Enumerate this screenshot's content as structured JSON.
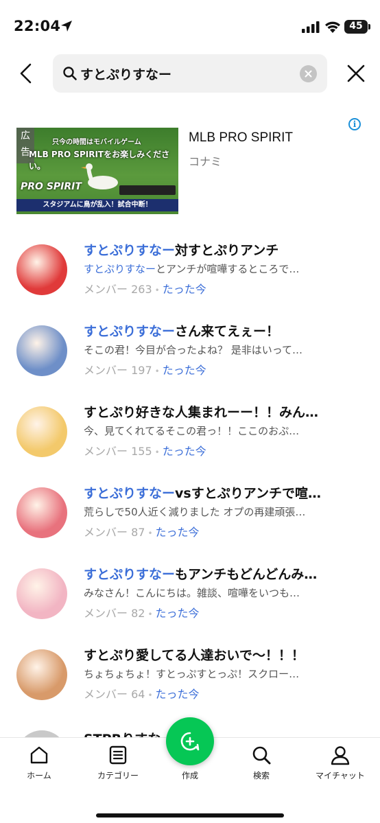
{
  "status_bar": {
    "time": "22:04",
    "battery": "45",
    "icons": [
      "location-arrow-icon",
      "cellular-signal-icon",
      "wifi-icon",
      "battery-icon"
    ]
  },
  "search": {
    "query": "すとぷりすなー",
    "icons": [
      "back-chevron-icon",
      "search-icon",
      "clear-icon",
      "close-x-icon"
    ]
  },
  "ad": {
    "badge": "広告",
    "image_caption": "只今の時間はモバイルゲーム",
    "image_headline": "MLB PRO SPIRITをお楽しみください。",
    "image_logo": "PRO SPIRIT",
    "image_banner": "スタジアムに鳥が乱入！試合中断！",
    "title": "MLB PRO SPIRIT",
    "sponsor": "コナミ",
    "info_icon": "info-icon"
  },
  "results": [
    {
      "title_highlight": "すとぷりすなー",
      "title_rest": "対すとぷりアンチ",
      "desc_highlight": "すとぷりすなー",
      "desc_rest": "とアンチが喧嘩するところで…",
      "members_label": "メンバー 263",
      "time": "たった今",
      "avatar_color": "#e03a3a"
    },
    {
      "title_highlight": "すとぷりすなー",
      "title_rest": "さん来てえぇー！",
      "desc_highlight": "",
      "desc_rest": "そこの君！今目が合ったよね？ 是非はいって…",
      "members_label": "メンバー 197",
      "time": "たった今",
      "avatar_color": "#6e8fc8"
    },
    {
      "title_highlight": "",
      "title_rest": "すとぷり好きな人集まれーー！！みん…",
      "desc_highlight": "",
      "desc_rest": "今、見てくれてるそこの君っ！！ここのおぷ…",
      "members_label": "メンバー 155",
      "time": "たった今",
      "avatar_color": "#f3c96b"
    },
    {
      "title_highlight": "すとぷりすなー",
      "title_rest": "vsすとぷりアンチで喧…",
      "desc_highlight": "",
      "desc_rest": "荒らしで50人近く減りました オプの再建頑張…",
      "members_label": "メンバー 87",
      "time": "たった今",
      "avatar_color": "#e8727d"
    },
    {
      "title_highlight": "すとぷりすなー",
      "title_rest": "もアンチもどんどんみ…",
      "desc_highlight": "",
      "desc_rest": "みなさん！こんにちは。雑談、喧嘩をいつも…",
      "members_label": "メンバー 82",
      "time": "たった今",
      "avatar_color": "#f2b5c3"
    },
    {
      "title_highlight": "",
      "title_rest": "すとぷり愛してる人達おいで〜！！！",
      "desc_highlight": "",
      "desc_rest": "ちょちょちょ！すとっぷすとっぷ！スクロー…",
      "members_label": "メンバー 64",
      "time": "たった今",
      "avatar_color": "#d89a6a"
    }
  ],
  "partial_result_title": "STPRりすな…",
  "fab": {
    "label": "作成",
    "icon": "chat-plus-icon"
  },
  "nav": [
    {
      "label": "ホーム",
      "icon": "home-icon"
    },
    {
      "label": "カテゴリー",
      "icon": "category-list-icon"
    },
    {
      "label": "作成",
      "icon": "create-icon"
    },
    {
      "label": "検索",
      "icon": "search-icon"
    },
    {
      "label": "マイチャット",
      "icon": "person-icon"
    }
  ],
  "colors": {
    "accent_green": "#06c755",
    "highlight_blue": "#3b6ed8",
    "meta_gray": "#a8a8a8"
  }
}
